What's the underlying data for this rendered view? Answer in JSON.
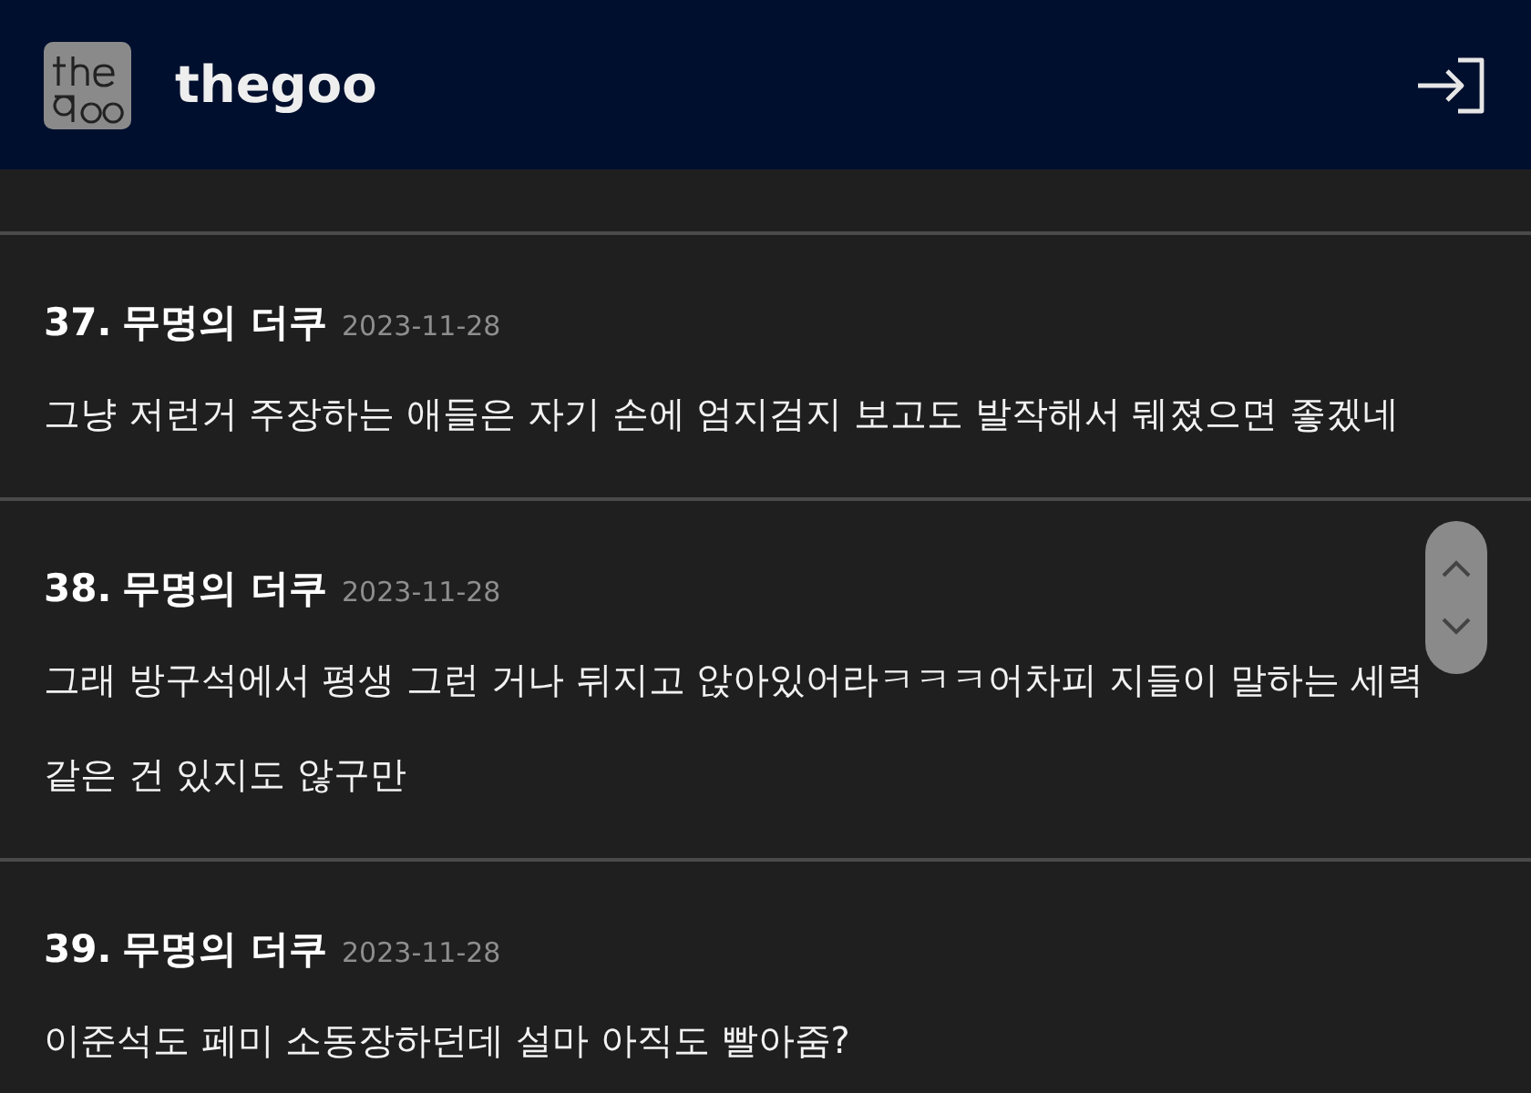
{
  "header": {
    "site_name": "thegoo"
  },
  "comments": [
    {
      "number": "37.",
      "author": "무명의 더쿠",
      "date": "2023-11-28",
      "text": "그냥 저런거 주장하는 애들은 자기 손에 엄지검지 보고도 발작해서 뒈졌으면 좋겠네"
    },
    {
      "number": "38.",
      "author": "무명의 더쿠",
      "date": "2023-11-28",
      "text": "그래 방구석에서 평생 그런 거나 뒤지고 앉아있어라ㅋㅋㅋ어차피 지들이 말하는 세력 같은 건 있지도 않구만"
    },
    {
      "number": "39.",
      "author": "무명의 더쿠",
      "date": "2023-11-28",
      "text": "이준석도 페미 소동장하던데 설마 아직도 빨아줌?"
    }
  ]
}
